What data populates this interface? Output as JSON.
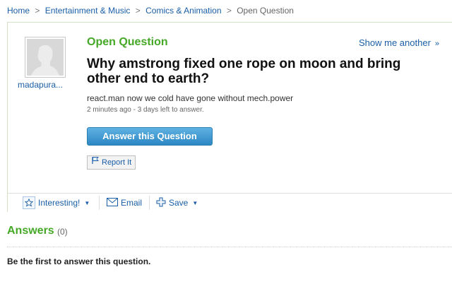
{
  "breadcrumb": {
    "items": [
      "Home",
      "Entertainment & Music",
      "Comics & Animation"
    ],
    "separator": ">",
    "current": "Open Question"
  },
  "question": {
    "status_label": "Open Question",
    "show_more_label": "Show me another",
    "show_more_glyph": "»",
    "author": "madapura...",
    "title": "Why amstrong fixed one rope on moon and bring other end to earth?",
    "details": "react.man now we cold have gone without mech.power",
    "meta": "2 minutes ago - 3 days left to answer.",
    "answer_button": "Answer this Question",
    "report_button": "Report It"
  },
  "toolbar": {
    "interesting_label": "Interesting!",
    "email_label": "Email",
    "save_label": "Save"
  },
  "answers": {
    "heading": "Answers",
    "count": "(0)",
    "empty_message": "Be the first to answer this question."
  },
  "colors": {
    "accent_green": "#45a827",
    "link_blue": "#1a5ea7",
    "button_blue": "#2c87c3"
  }
}
